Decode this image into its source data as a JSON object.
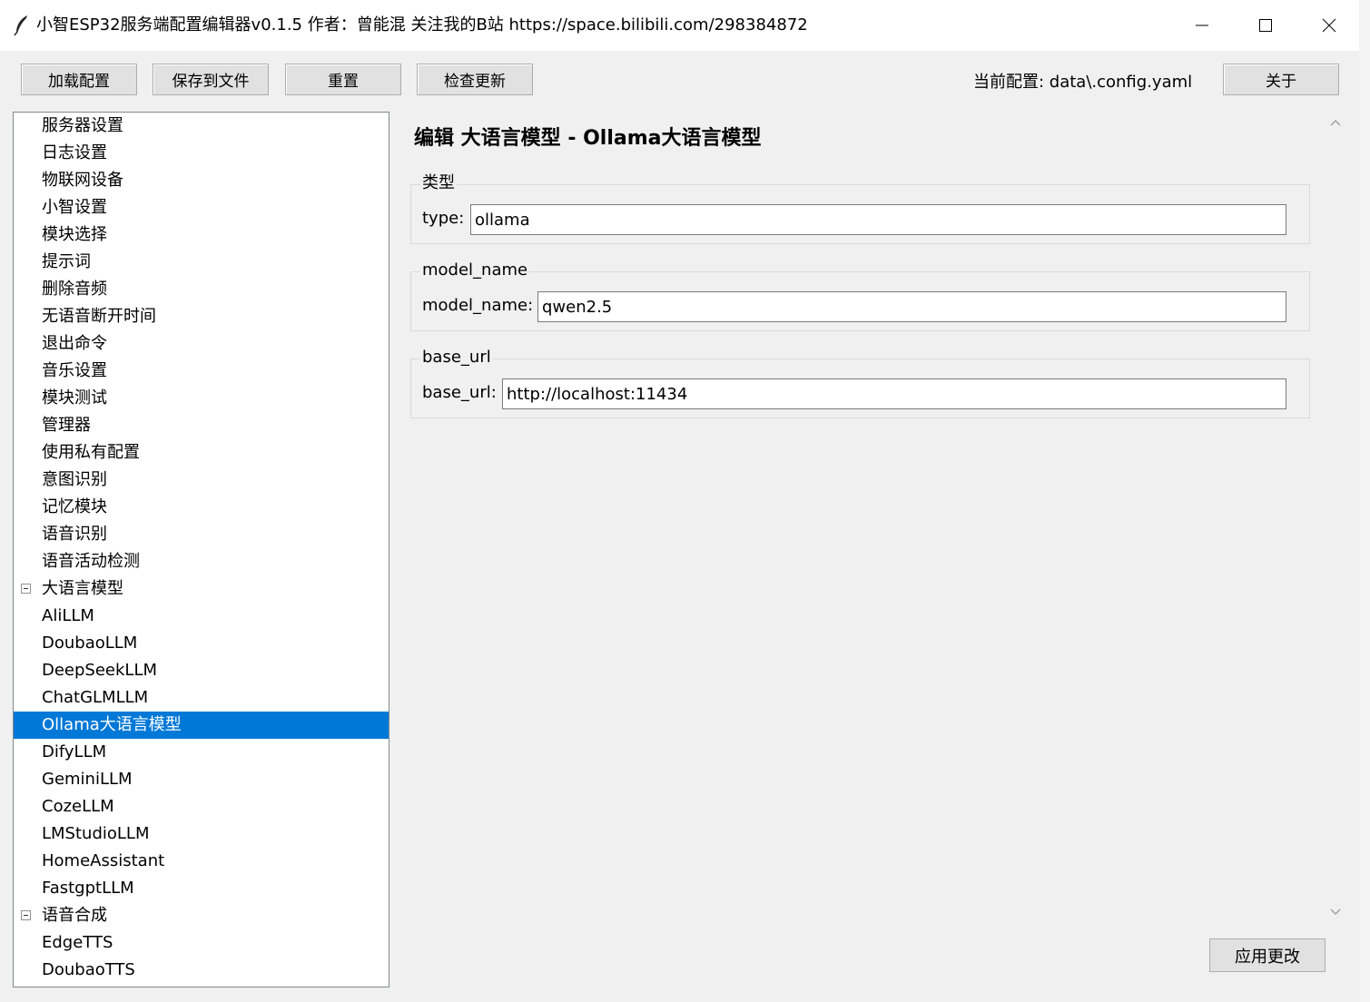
{
  "window": {
    "title": "小智ESP32服务端配置编辑器v0.1.5  作者：曾能混 关注我的B站 https://space.bilibili.com/298384872",
    "icons": {
      "app": "feather-icon",
      "minimize": "minimize-icon",
      "maximize": "maximize-icon",
      "close": "close-icon"
    }
  },
  "toolbar": {
    "load_label": "加载配置",
    "save_label": "保存到文件",
    "reset_label": "重置",
    "update_label": "检查更新",
    "current_config": "当前配置: data\\.config.yaml",
    "about_label": "关于"
  },
  "tree": {
    "items": [
      {
        "label": "服务器设置"
      },
      {
        "label": "日志设置"
      },
      {
        "label": "物联网设备"
      },
      {
        "label": "小智设置"
      },
      {
        "label": "模块选择"
      },
      {
        "label": "提示词"
      },
      {
        "label": "删除音频"
      },
      {
        "label": "无语音断开时间"
      },
      {
        "label": "退出命令"
      },
      {
        "label": "音乐设置"
      },
      {
        "label": "模块测试"
      },
      {
        "label": "管理器"
      },
      {
        "label": "使用私有配置"
      },
      {
        "label": "意图识别"
      },
      {
        "label": "记忆模块"
      },
      {
        "label": "语音识别"
      },
      {
        "label": "语音活动检测"
      },
      {
        "label": "大语言模型",
        "expanded": true
      },
      {
        "label": "AliLLM"
      },
      {
        "label": "DoubaoLLM"
      },
      {
        "label": "DeepSeekLLM"
      },
      {
        "label": "ChatGLMLLM"
      },
      {
        "label": "Ollama大语言模型",
        "selected": true
      },
      {
        "label": "DifyLLM"
      },
      {
        "label": "GeminiLLM"
      },
      {
        "label": "CozeLLM"
      },
      {
        "label": "LMStudioLLM"
      },
      {
        "label": "HomeAssistant"
      },
      {
        "label": "FastgptLLM"
      },
      {
        "label": "语音合成",
        "expanded": true
      },
      {
        "label": "EdgeTTS"
      },
      {
        "label": "DoubaoTTS"
      }
    ]
  },
  "editor": {
    "title": "编辑 大语言模型 - Ollama大语言模型",
    "groups": [
      {
        "legend": "类型",
        "label": "type:",
        "value": "ollama"
      },
      {
        "legend": "model_name",
        "label": "model_name:",
        "value": "qwen2.5"
      },
      {
        "legend": "base_url",
        "label": "base_url:",
        "value": "http://localhost:11434"
      }
    ],
    "apply_label": "应用更改"
  },
  "colors": {
    "selection": "#0078d7",
    "window_bg": "#f0f0f0",
    "button_bg": "#e1e1e1"
  }
}
